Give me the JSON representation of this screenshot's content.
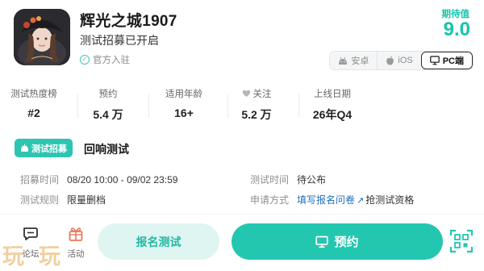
{
  "header": {
    "title": "辉光之城1907",
    "subtitle": "测试招募已开启",
    "official_label": "官方入驻",
    "score_label": "期待值",
    "score_value": "9.0"
  },
  "platforms": [
    {
      "label": "安卓",
      "icon": "android-icon",
      "active": false
    },
    {
      "label": "iOS",
      "icon": "apple-icon",
      "active": false
    },
    {
      "label": "PC端",
      "icon": "monitor-icon",
      "active": true
    }
  ],
  "stats": [
    {
      "label": "测试热度榜",
      "value": "#2"
    },
    {
      "label": "预约",
      "value": "5.4 万"
    },
    {
      "label": "适用年龄",
      "value": "16+"
    },
    {
      "label": "关注",
      "value": "5.2 万",
      "icon": "heart-icon"
    },
    {
      "label": "上线日期",
      "value": "26年Q4"
    }
  ],
  "recruit": {
    "tag": "测试招募",
    "title": "回响测试",
    "rows": [
      {
        "key": "招募时间",
        "value": "08/20 10:00 - 09/02 23:59"
      },
      {
        "key": "测试时间",
        "value": "待公布"
      },
      {
        "key": "测试规则",
        "value": "限量删档"
      },
      {
        "key": "申请方式",
        "link": "填写报名问卷",
        "after": "抢测试资格"
      }
    ]
  },
  "bottom": {
    "forum_label": "论坛",
    "activity_label": "活动",
    "signup_label": "报名测试",
    "reserve_label": "预约"
  },
  "watermark": "玩玩",
  "colors": {
    "accent": "#23c7b0",
    "link": "#1e6fb8",
    "muted": "#8f8f8f"
  }
}
